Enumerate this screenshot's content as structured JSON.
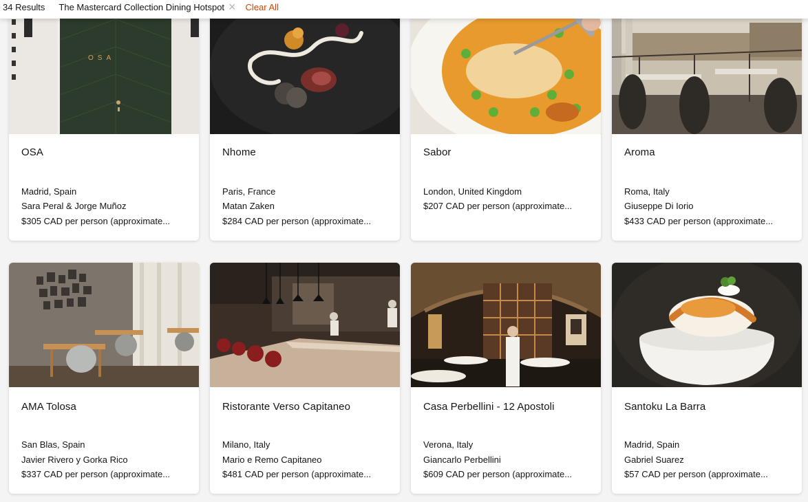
{
  "filters": {
    "results": "34 Results",
    "chip_label": "The Mastercard Collection Dining Hotspot",
    "chip_close": "×",
    "clear_all": "Clear All"
  },
  "cards": [
    {
      "name": "OSA",
      "location": "Madrid, Spain",
      "chef": "Sara Peral & Jorge Muñoz",
      "price": "$305 CAD per person (approximate..."
    },
    {
      "name": "Nhome",
      "location": "Paris, France",
      "chef": "Matan Zaken",
      "price": "$284 CAD per person (approximate..."
    },
    {
      "name": "Sabor",
      "location": "London, United Kingdom",
      "chef": "",
      "price": "$207 CAD per person (approximate..."
    },
    {
      "name": "Aroma",
      "location": "Roma, Italy",
      "chef": "Giuseppe Di Iorio",
      "price": "$433 CAD per person (approximate..."
    },
    {
      "name": "AMA Tolosa",
      "location": "San Blas, Spain",
      "chef": "Javier Rivero y Gorka Rico",
      "price": "$337 CAD per person (approximate..."
    },
    {
      "name": "Ristorante Verso Capitaneo",
      "location": "Milano, Italy",
      "chef": "Mario e Remo Capitaneo",
      "price": "$481 CAD per person (approximate..."
    },
    {
      "name": "Casa Perbellini - 12 Apostoli",
      "location": "Verona, Italy",
      "chef": "Giancarlo Perbellini",
      "price": "$609 CAD per person (approximate..."
    },
    {
      "name": "Santoku La Barra",
      "location": "Madrid, Spain",
      "chef": "Gabriel Suarez",
      "price": "$57 CAD per person (approximate..."
    }
  ],
  "images": {
    "osa_door_sign": "OSA"
  },
  "colors": {
    "accent": "#cf4500",
    "text": "#141413",
    "card_bg": "#ffffff",
    "page_bg": "#f4f4f4"
  }
}
